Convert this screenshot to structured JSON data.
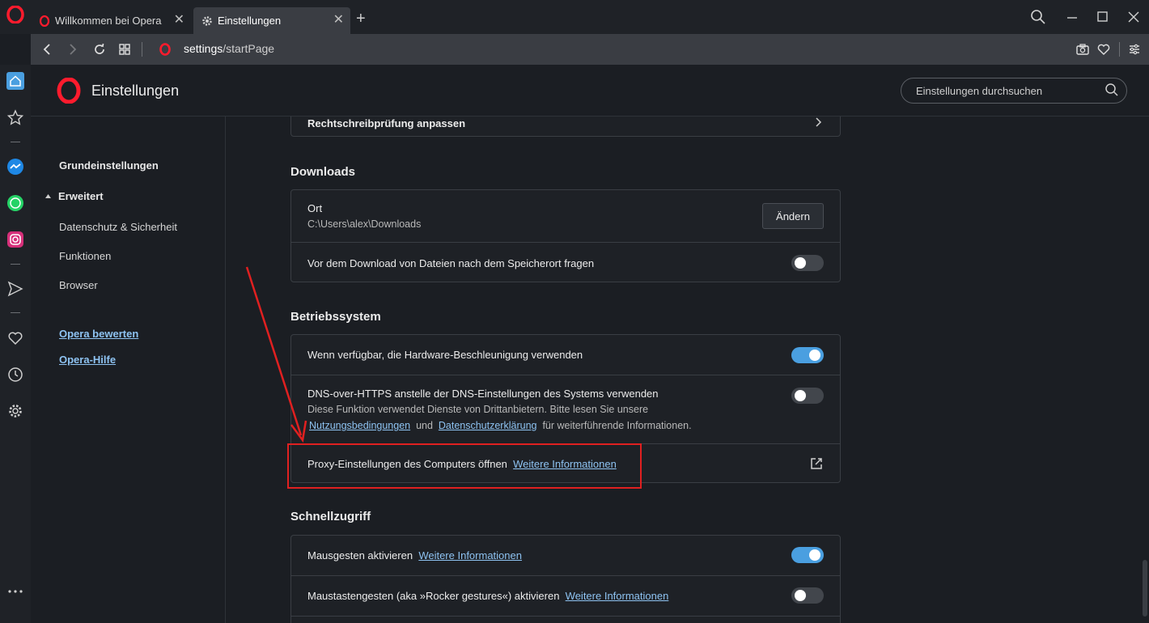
{
  "tabs": [
    {
      "label": "Willkommen bei Opera",
      "active": false
    },
    {
      "label": "Einstellungen",
      "active": true
    }
  ],
  "address": {
    "host": "settings",
    "path": "/startPage"
  },
  "header": {
    "title": "Einstellungen",
    "search_placeholder": "Einstellungen durchsuchen"
  },
  "nav": {
    "basic": "Grundeinstellungen",
    "advanced": "Erweitert",
    "privacy": "Datenschutz & Sicherheit",
    "features": "Funktionen",
    "browser": "Browser",
    "rate": "Opera bewerten",
    "help": "Opera-Hilfe"
  },
  "spellcheck": {
    "label": "Rechtschreibprüfung anpassen"
  },
  "downloads": {
    "title": "Downloads",
    "location_label": "Ort",
    "location_path": "C:\\Users\\alex\\Downloads",
    "change_button": "Ändern",
    "ask_label": "Vor dem Download von Dateien nach dem Speicherort fragen",
    "ask_enabled": false
  },
  "system": {
    "title": "Betriebssystem",
    "hw_accel_label": "Wenn verfügbar, die Hardware-Beschleunigung verwenden",
    "hw_accel_enabled": true,
    "doh_label": "DNS-over-HTTPS anstelle der DNS-Einstellungen des Systems verwenden",
    "doh_desc": "Diese Funktion verwendet Dienste von Drittanbietern. Bitte lesen Sie unsere",
    "doh_terms": "Nutzungsbedingungen",
    "doh_and": "und",
    "doh_privacy": "Datenschutzerklärung",
    "doh_tail": "für weiterführende Informationen.",
    "doh_enabled": false,
    "proxy_label": "Proxy-Einstellungen des Computers öffnen",
    "proxy_link": "Weitere Informationen"
  },
  "quick": {
    "title": "Schnellzugriff",
    "mouse_label": "Mausgesten aktivieren",
    "mouse_link": "Weitere Informationen",
    "mouse_enabled": true,
    "rocker_label": "Maustastengesten (aka »Rocker gestures«) aktivieren",
    "rocker_link": "Weitere Informationen",
    "rocker_enabled": false
  },
  "colors": {
    "accent": "#4a9fe0",
    "link": "#8ec3f2",
    "opera_red": "#ff1b2d",
    "annotation": "#e02020"
  }
}
